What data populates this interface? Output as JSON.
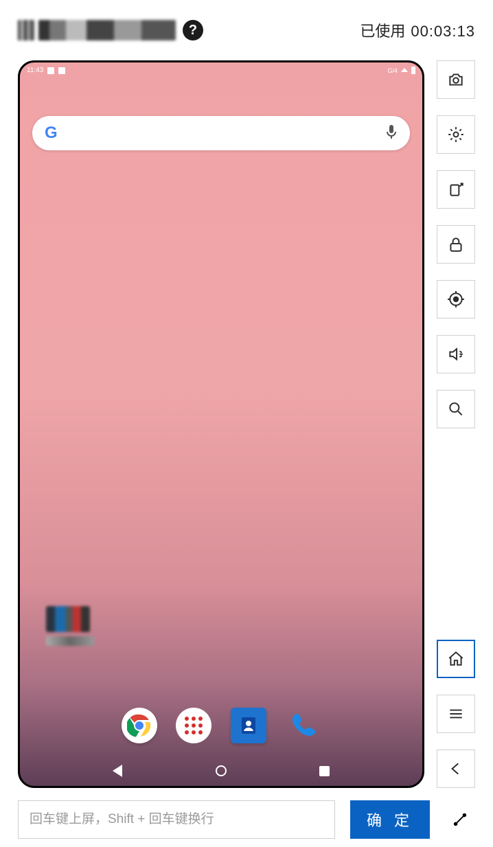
{
  "header": {
    "help_symbol": "?",
    "usage_label": "已使用",
    "usage_time": "00:03:13"
  },
  "device": {
    "status_time": "11:43",
    "search_logo_letter": "G"
  },
  "sidebar": {
    "top_buttons": [
      {
        "name": "camera-icon"
      },
      {
        "name": "gear-icon"
      },
      {
        "name": "rotate-icon"
      },
      {
        "name": "lock-icon"
      },
      {
        "name": "locate-icon"
      },
      {
        "name": "volume-icon"
      },
      {
        "name": "search-icon"
      }
    ],
    "bottom_buttons": [
      {
        "name": "home-icon",
        "active": true
      },
      {
        "name": "menu-icon"
      },
      {
        "name": "back-icon"
      }
    ]
  },
  "bottom": {
    "input_placeholder": "回车键上屏，Shift + 回车键换行",
    "submit_label": "确 定"
  }
}
